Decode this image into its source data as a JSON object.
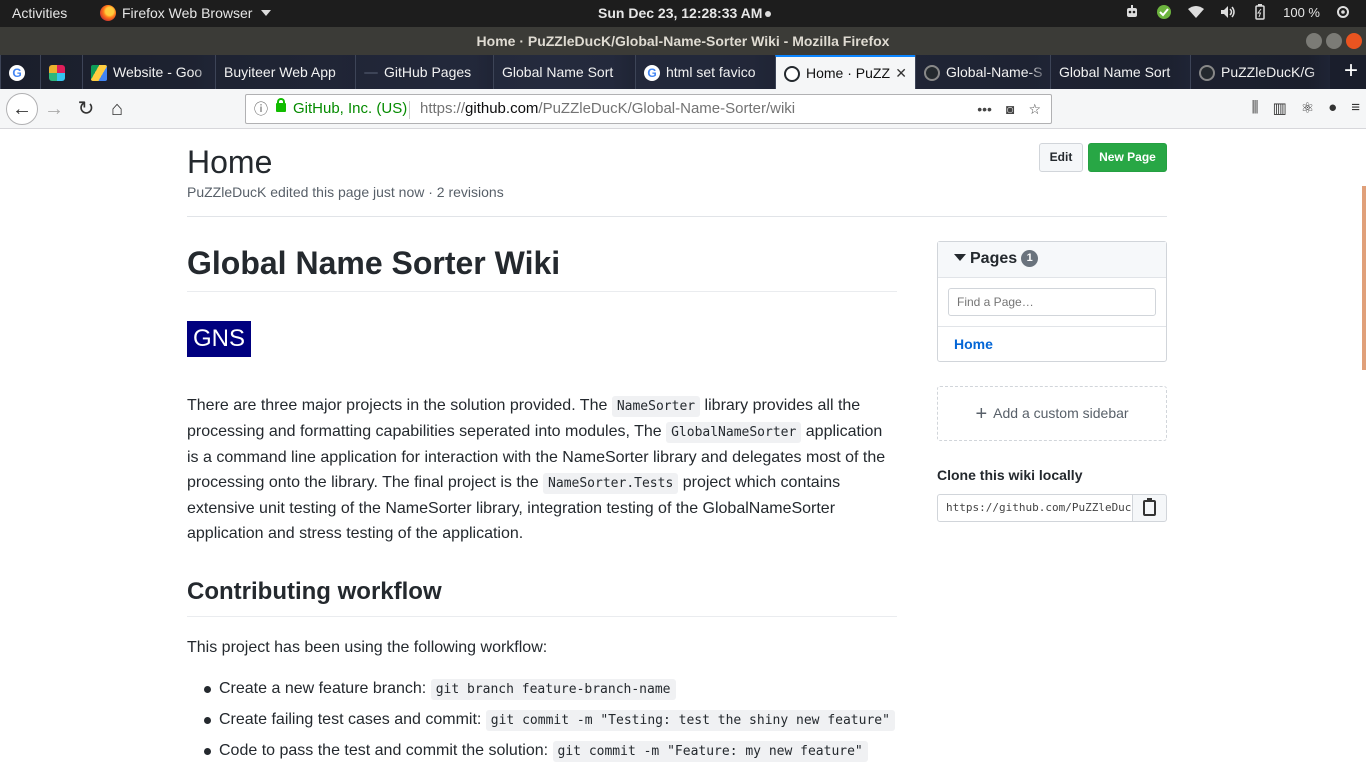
{
  "topbar": {
    "activities": "Activities",
    "app_name": "Firefox Web Browser",
    "clock": "Sun Dec 23, 12:28:33 AM",
    "battery": "100 %"
  },
  "window": {
    "title": "Home · PuZZleDucK/Global-Name-Sorter Wiki - Mozilla Firefox"
  },
  "tabs": [
    {
      "label": ""
    },
    {
      "label": ""
    },
    {
      "label": "Website - Goo"
    },
    {
      "label": "Buyiteer Web App"
    },
    {
      "label": "GitHub Pages"
    },
    {
      "label": "Global Name Sort"
    },
    {
      "label": "html set favico"
    },
    {
      "label": "Home · PuZZ"
    },
    {
      "label": "Global-Name-S"
    },
    {
      "label": "Global Name Sort"
    },
    {
      "label": "PuZZleDucK/G"
    }
  ],
  "urlbar": {
    "identity": "GitHub, Inc. (US)",
    "url_prefix": "https://",
    "url_domain": "github.com",
    "url_path": "/PuZZleDucK/Global-Name-Sorter/wiki",
    "more": "•••"
  },
  "page": {
    "title": "Home",
    "meta": "PuZZleDucK edited this page just now · 2 revisions",
    "edit_label": "Edit",
    "new_page_label": "New Page"
  },
  "article": {
    "h1": "Global Name Sorter Wiki",
    "logo_text": "GNS",
    "p1_a": "There are three major projects in the solution provided. The ",
    "p1_code1": "NameSorter",
    "p1_b": " library provides all the processing and formatting capabilities seperated into modules, The ",
    "p1_code2": "GlobalNameSorter",
    "p1_c": " application is a command line application for interaction with the NameSorter library and delegates most of the processing onto the library. The final project is the ",
    "p1_code3": "NameSorter.Tests",
    "p1_d": " project which contains extensive unit testing of the NameSorter library, integration testing of the GlobalNameSorter application and stress testing of the application.",
    "h2": "Contributing workflow",
    "p2": "This project has been using the following workflow:",
    "list": [
      {
        "text": "Create a new feature branch: ",
        "code": "git branch feature-branch-name"
      },
      {
        "text": "Create failing test cases and commit: ",
        "code": "git commit -m \"Testing: test the shiny new feature\""
      },
      {
        "text": "Code to pass the test and commit the solution: ",
        "code": "git commit -m \"Feature: my new feature\""
      }
    ]
  },
  "sidebar": {
    "pages_label": "Pages",
    "pages_count": "1",
    "find_placeholder": "Find a Page…",
    "home_link": "Home",
    "custom_sidebar": "Add a custom sidebar",
    "clone_heading": "Clone this wiki locally",
    "clone_url": "https://github.com/PuZZleDucK/Global-Name-Sorter.wiki.git"
  }
}
